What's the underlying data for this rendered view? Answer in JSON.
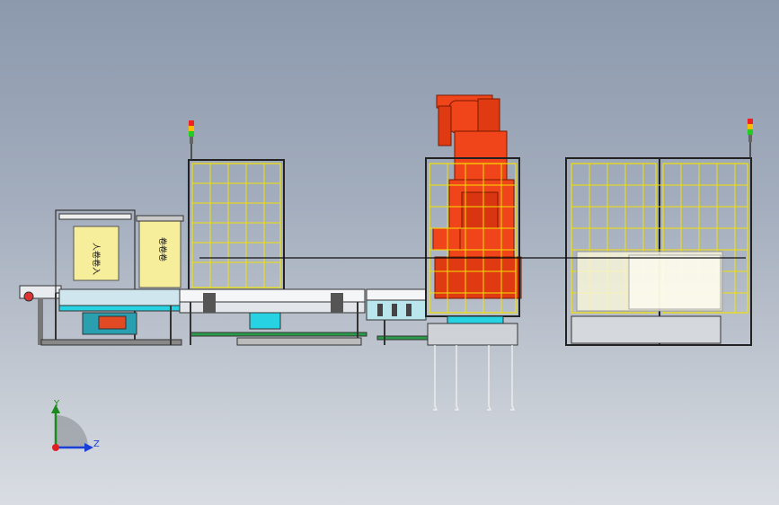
{
  "colors": {
    "background_top": "#8c99ad",
    "background_bottom": "#d9dde3",
    "robot": "#f0441a",
    "guard_mesh": "#f3e000",
    "conveyor_base": "#27d2e2",
    "machine_body": "#f6ee9a"
  },
  "labels": {
    "unwinder_left": "人卷卷入",
    "unwinder_right": "卷卷卷"
  },
  "triad": {
    "y_label": "Y",
    "z_label": "Z"
  },
  "icons": [
    "signal-tower-icon",
    "coordinate-triad-icon"
  ]
}
